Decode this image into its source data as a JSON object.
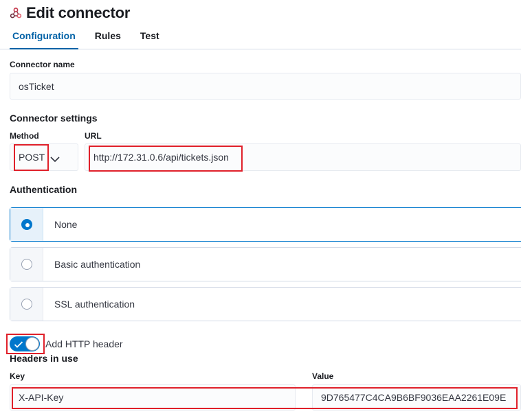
{
  "header": {
    "title": "Edit connector",
    "icon": "webhook-icon",
    "tabs": [
      {
        "label": "Configuration",
        "active": true
      },
      {
        "label": "Rules",
        "active": false
      },
      {
        "label": "Test",
        "active": false
      }
    ]
  },
  "connector_name": {
    "label": "Connector name",
    "value": "osTicket"
  },
  "connector_settings": {
    "title": "Connector settings",
    "method_label": "Method",
    "method_value": "POST",
    "url_label": "URL",
    "url_value": "http://172.31.0.6/api/tickets.json"
  },
  "authentication": {
    "title": "Authentication",
    "options": [
      {
        "label": "None",
        "selected": true
      },
      {
        "label": "Basic authentication",
        "selected": false
      },
      {
        "label": "SSL authentication",
        "selected": false
      }
    ]
  },
  "headers": {
    "toggle_label": "Add HTTP header",
    "toggle_on": true,
    "title": "Headers in use",
    "key_label": "Key",
    "value_label": "Value",
    "key_value": "X-API-Key",
    "value_value": "9D765477C4CA9B6BF9036EAA2261E09E"
  },
  "colors": {
    "accent": "#0077cc",
    "highlight": "#e0202a"
  }
}
